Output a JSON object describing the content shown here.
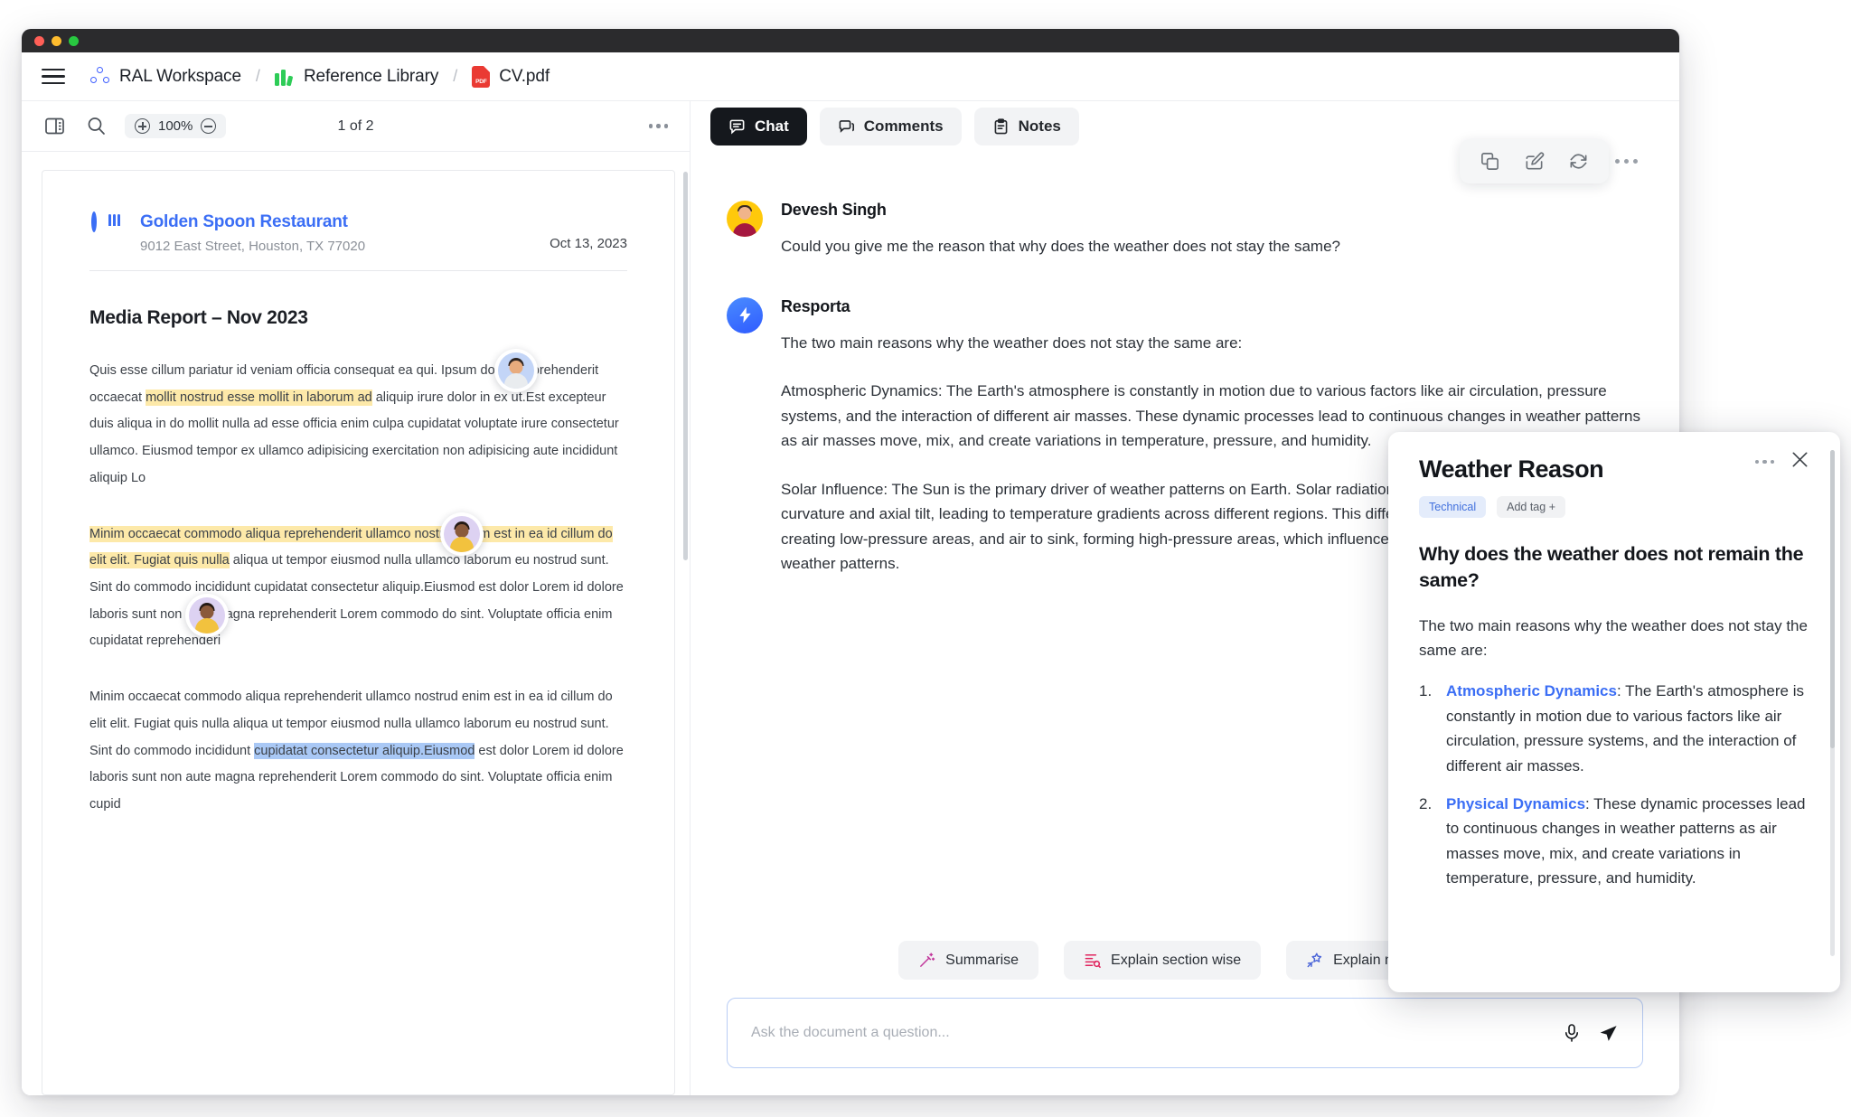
{
  "window": {
    "traffic_lights": [
      "close",
      "minimize",
      "maximize"
    ]
  },
  "breadcrumb": {
    "menu_icon": "hamburger-icon",
    "items": [
      {
        "label": "RAL Workspace",
        "icon": "workspace-icon"
      },
      {
        "label": "Reference Library",
        "icon": "library-icon"
      },
      {
        "label": "CV.pdf",
        "icon": "pdf-file-icon"
      }
    ],
    "separator": "/"
  },
  "pdf_toolbar": {
    "sidebar_icon": "panel-toggle-icon",
    "search_icon": "search-icon",
    "zoom_in_icon": "zoom-in-icon",
    "zoom_out_icon": "zoom-out-icon",
    "zoom_level": "100%",
    "page_indicator": "1 of 2",
    "more_icon": "more-horizontal-icon"
  },
  "document": {
    "business_name": "Golden Spoon Restaurant",
    "business_address": "9012 East Street, Houston, TX 77020",
    "date": "Oct 13, 2023",
    "title": "Media Report – Nov 2023",
    "paragraphs": [
      {
        "parts": [
          {
            "text": "Quis esse cillum pariatur id veniam officia consequat ea qui. Ipsum dolore reprehenderit occaecat ",
            "style": "plain"
          },
          {
            "text": "mollit nostrud esse mollit in laborum ad",
            "style": "highlight-yellow"
          },
          {
            "text": " aliquip irure dolor in ex ut.Est excepteur duis aliqua in do mollit nulla ad esse officia enim culpa cupidatat voluptate irure consectetur ullamco. Eiusmod tempor ex ullamco adipisicing exercitation non adipisicing aute incididunt aliquip Lo",
            "style": "plain"
          }
        ]
      },
      {
        "parts": [
          {
            "text": "Minim occaecat commodo aliqua reprehenderit ullamco nostrud enim est in ea id cillum do elit elit. Fugiat quis nulla",
            "style": "highlight-yellow"
          },
          {
            "text": " aliqua ut tempor eiusmod nulla ullamco laborum eu nostrud sunt. Sint do commodo incididunt cupidatat consectetur aliquip.Eiusmod est dolor Lorem id dolore laboris sunt non aute magna reprehenderit Lorem commodo do sint. Voluptate officia enim cupidatat reprehenderi",
            "style": "plain"
          }
        ]
      },
      {
        "parts": [
          {
            "text": "Minim occaecat commodo aliqua reprehenderit ullamco nostrud enim est in ea id cillum do elit elit. Fugiat quis nulla aliqua ut tempor eiusmod nulla ullamco laborum eu nostrud sunt. Sint do commodo incididunt ",
            "style": "plain"
          },
          {
            "text": "cupidatat consectetur aliquip.Eiusmod",
            "style": "highlight-blue"
          },
          {
            "text": " est dolor Lorem id dolore laboris sunt non aute magna reprehenderit Lorem commodo do sint. Voluptate officia enim cupid",
            "style": "plain"
          }
        ]
      }
    ],
    "annotation_avatars": [
      "commenter-avatar-1",
      "commenter-avatar-2",
      "commenter-avatar-3"
    ]
  },
  "chat": {
    "tabs": [
      {
        "label": "Chat",
        "icon": "chat-bubble-icon",
        "active": true
      },
      {
        "label": "Comments",
        "icon": "comments-icon",
        "active": false
      },
      {
        "label": "Notes",
        "icon": "notes-clipboard-icon",
        "active": false
      }
    ],
    "thread_more_icon": "more-horizontal-icon",
    "messages": [
      {
        "author": "Devesh Singh",
        "avatar": "user-avatar",
        "paragraphs": [
          "Could you give me the reason that why does the weather does not stay the same?"
        ]
      },
      {
        "author": "Resporta",
        "avatar": "bot-bolt-avatar",
        "paragraphs": [
          "The two main reasons why the weather does not stay the same are:",
          "Atmospheric Dynamics: The Earth's atmosphere is constantly in motion due to various factors like air circulation, pressure systems, and the interaction of different air masses. These dynamic processes lead to continuous changes in weather patterns as air masses move, mix, and create variations in temperature, pressure, and humidity.",
          "Solar Influence: The Sun is the primary driver of weather patterns on Earth. Solar radiation heats the Earth unevenly due to its curvature and axial tilt, leading to temperature gradients across different regions. This differential heating causes air to rise, creating low-pressure areas, and air to sink, forming high-pressure areas, which influence the movement of air masses and weather patterns."
        ]
      }
    ],
    "quick_actions": [
      {
        "label": "Summarise",
        "icon": "magic-wand-icon"
      },
      {
        "label": "Explain section wise",
        "icon": "section-list-icon"
      },
      {
        "label": "Explain me a topic",
        "icon": "shooting-star-icon"
      }
    ],
    "composer": {
      "placeholder": "Ask the document a question...",
      "value": "",
      "mic_icon": "microphone-icon",
      "send_icon": "send-icon"
    }
  },
  "float_tools": [
    {
      "icon": "copy-icon",
      "name": "copy"
    },
    {
      "icon": "edit-icon",
      "name": "edit"
    },
    {
      "icon": "refresh-icon",
      "name": "regenerate"
    }
  ],
  "note_card": {
    "title": "Weather Reason",
    "more_icon": "more-horizontal-icon",
    "close_icon": "close-icon",
    "tags": [
      {
        "label": "Technical",
        "type": "applied"
      },
      {
        "label": "Add tag +",
        "type": "add"
      }
    ],
    "question": "Why does the weather does not remain the same?",
    "intro": "The two main reasons why the weather does not stay the same are:",
    "list": [
      {
        "number": "1.",
        "term": "Atmospheric Dynamics",
        "text": ": The Earth's atmosphere is constantly in motion due to various factors like air circulation, pressure systems, and the interaction of different air masses."
      },
      {
        "number": "2.",
        "term": "Physical Dynamics",
        "text": ": These dynamic processes lead to continuous changes in weather patterns as air masses move, mix, and create variations in temperature, pressure, and humidity."
      }
    ]
  },
  "colors": {
    "accent_blue": "#3b6ef5",
    "active_tab_bg": "#15181d",
    "highlight_yellow": "#fde9a9",
    "highlight_blue": "#a9c8f5",
    "pdf_red": "#ea3a33",
    "library_green": "#2ecc57",
    "user_avatar_yellow": "#ffc90b"
  }
}
